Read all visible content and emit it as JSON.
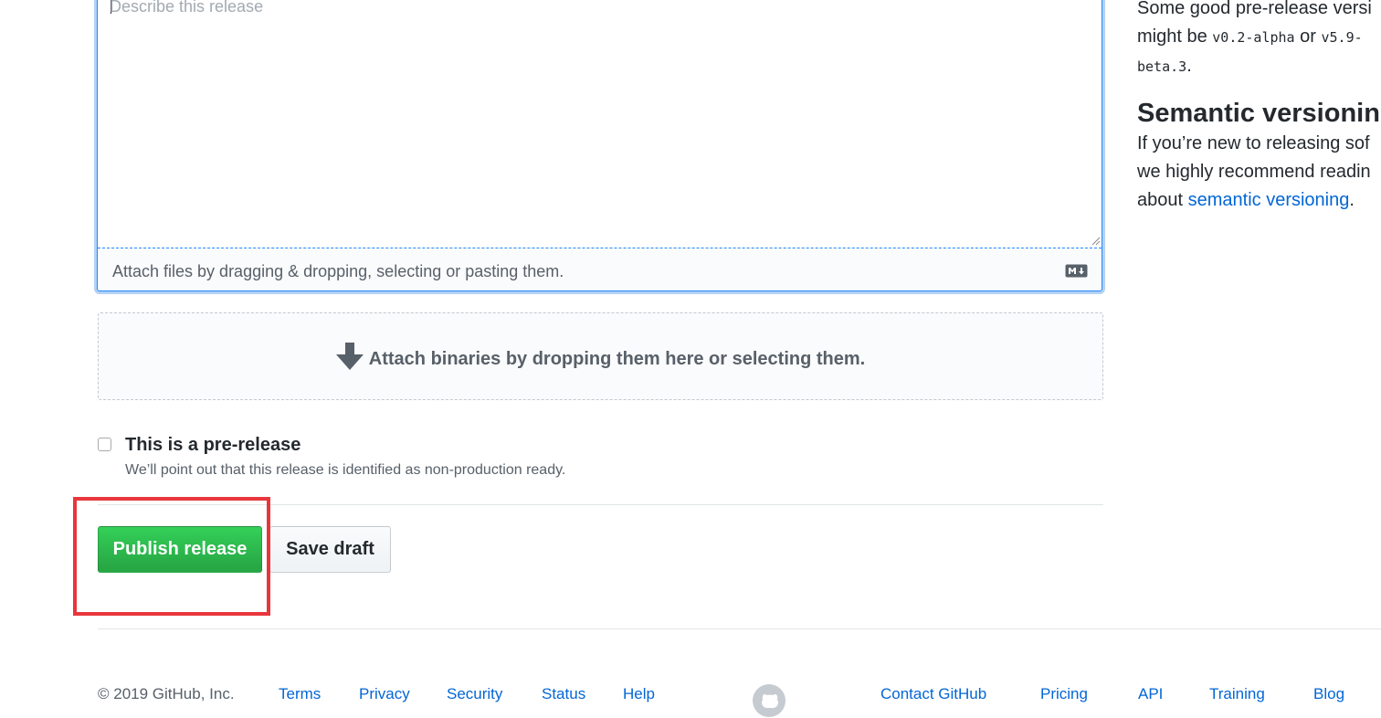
{
  "editor": {
    "placeholder": "Describe this release",
    "attach_text": "Attach files by dragging & dropping, selecting or pasting them.",
    "markdown_icon": "markdown-icon"
  },
  "dropzone": {
    "text": "Attach binaries by dropping them here or selecting them.",
    "icon": "arrow-down-icon"
  },
  "prerelease": {
    "label": "This is a pre-release",
    "note": "We’ll point out that this release is identified as non-production ready.",
    "checked": false
  },
  "actions": {
    "publish_label": "Publish release",
    "draft_label": "Save draft"
  },
  "sidebar": {
    "prerelease_line1": "Some good pre-release versi",
    "prerelease_line2_prefix": "might be ",
    "code1": "v0.2-alpha",
    "or_text": " or ",
    "code2_part1": "v5.9-",
    "code2_part2": "beta.3",
    "period": ".",
    "semver_heading": "Semantic versioning",
    "semver_line1": "If you’re new to releasing sof",
    "semver_line2": "we highly recommend readin",
    "semver_line3_prefix": "about ",
    "semver_link": "semantic versioning",
    "semver_suffix": "."
  },
  "footer": {
    "copyright": "© 2019 GitHub, Inc.",
    "links_left": [
      "Terms",
      "Privacy",
      "Security",
      "Status",
      "Help"
    ],
    "links_right": [
      "Contact GitHub",
      "Pricing",
      "API",
      "Training",
      "Blog"
    ],
    "logo_icon": "github-mark-icon"
  },
  "colors": {
    "primary_green": "#28a745",
    "link_blue": "#0366d6",
    "highlight_red": "#e8363c",
    "focus_blue": "#2188ff"
  }
}
